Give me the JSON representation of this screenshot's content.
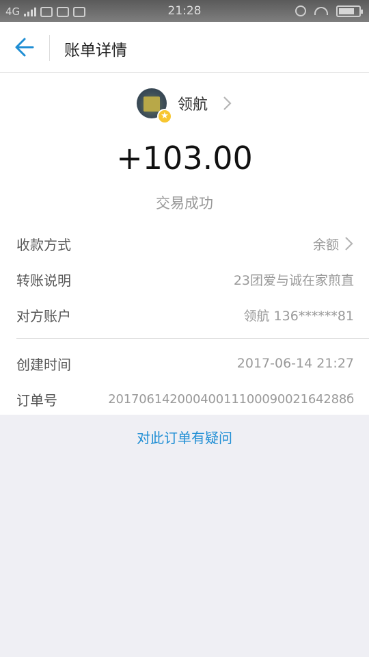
{
  "status_bar": {
    "network": "4G",
    "time": "21:28"
  },
  "nav": {
    "back_icon": "back-arrow-icon",
    "title": "账单详情"
  },
  "payee": {
    "name": "领航",
    "badge_icon": "star-icon"
  },
  "transaction": {
    "amount": "+103.00",
    "status": "交易成功"
  },
  "details": [
    {
      "label": "收款方式",
      "value": "余额"
    },
    {
      "label": "转账说明",
      "value": "23团爱与诚在家煎直"
    },
    {
      "label": "对方账户",
      "value": "领航 136******81"
    },
    {
      "label": "创建时间",
      "value": "2017-06-14 21:27"
    },
    {
      "label": "订单号",
      "value": "2017061420004001110009002164288б"
    }
  ],
  "question_link": "对此订单有疑问",
  "colors": {
    "accent": "#1f8ed4",
    "background": "#efeff4",
    "badge": "#f7c630"
  }
}
